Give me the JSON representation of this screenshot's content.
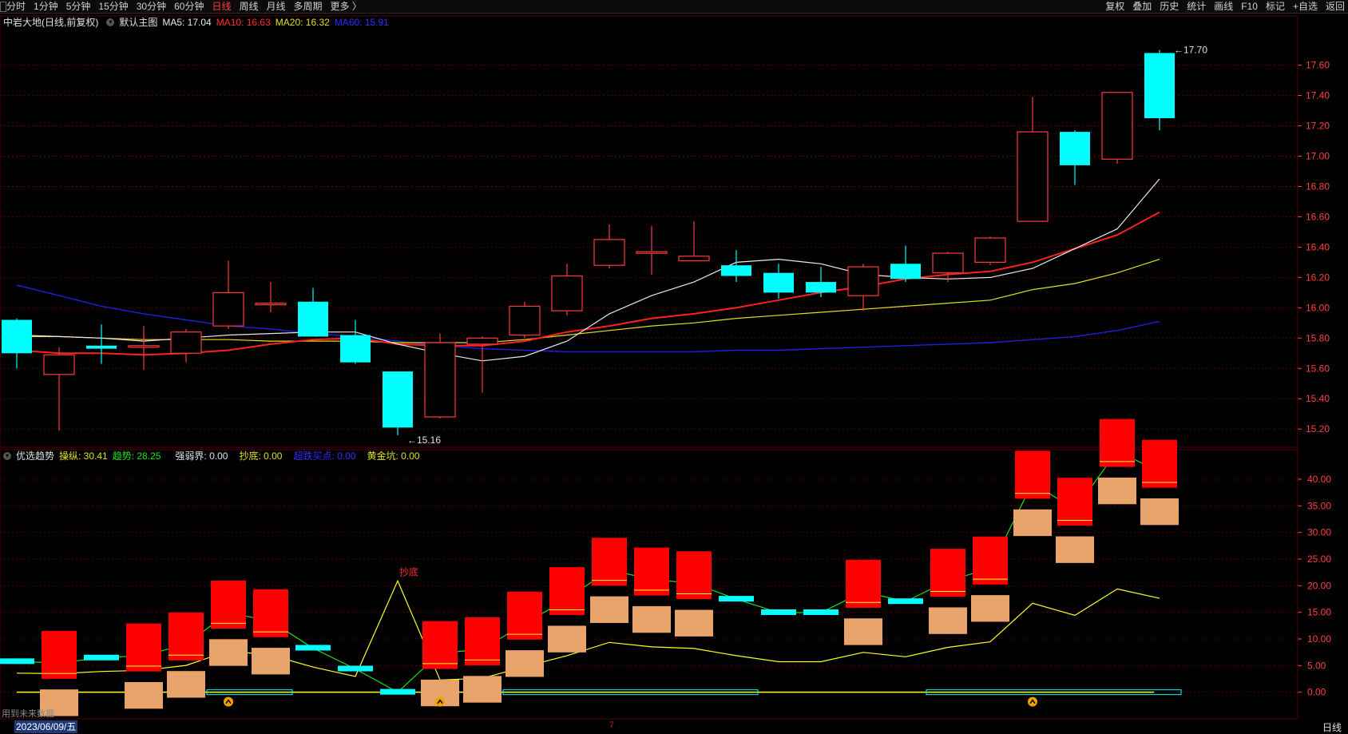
{
  "toolbar": {
    "periods": [
      "分时",
      "1分钟",
      "5分钟",
      "15分钟",
      "30分钟",
      "60分钟",
      "日线",
      "周线",
      "月线",
      "多周期",
      "更多 〉"
    ],
    "active_period": "日线",
    "tools": [
      "复权",
      "叠加",
      "历史",
      "统计",
      "画线",
      "F10",
      "标记",
      "+自选",
      "返回"
    ]
  },
  "main_header": {
    "stock": "中岩大地(日线,前复权)",
    "template": "默认主图",
    "ma5": "MA5: 17.04",
    "ma10": "MA10: 16.63",
    "ma20": "MA20: 16.32",
    "ma60": "MA60: 15.91"
  },
  "indicator_header": {
    "name": "优选趋势",
    "caozong": "操纵: 30.41",
    "qushi": "趋势: 28.25",
    "qiangruo": "强弱界: 0.00",
    "chaodi": "抄底: 0.00",
    "chaodie": "超跌买点: 0.00",
    "huangjin": "黄金坑: 0.00"
  },
  "colors": {
    "up": "#ff3b3b",
    "down": "#00ffff",
    "ma5": "#e8e8e8",
    "ma10": "#ff2020",
    "ma20": "#e0e020",
    "ma60": "#2020e0",
    "grid": "#5a0000",
    "axis": "#ff4040",
    "ind_red": "#ff0000",
    "ind_orange": "#e8a46a",
    "ind_yellow": "#ffff20",
    "ind_cyan": "#00ffff",
    "ind_green": "#20e020"
  },
  "price_axis": {
    "min": 15.08,
    "max": 17.84,
    "ticks": [
      "17.60",
      "17.40",
      "17.20",
      "17.00",
      "16.80",
      "16.60",
      "16.40",
      "16.20",
      "16.00",
      "15.80",
      "15.60",
      "15.40",
      "15.20"
    ],
    "tick_values": [
      17.6,
      17.4,
      17.2,
      17.0,
      16.8,
      16.6,
      16.4,
      16.2,
      16.0,
      15.8,
      15.6,
      15.4,
      15.2
    ]
  },
  "ind_axis": {
    "min": -5.0,
    "max": 43.0,
    "ticks": [
      "40.00",
      "35.00",
      "30.00",
      "25.00",
      "20.00",
      "15.00",
      "10.00",
      "5.00",
      "0.00"
    ],
    "tick_values": [
      40,
      35,
      30,
      25,
      20,
      15,
      10,
      5,
      0
    ]
  },
  "chart_data": {
    "type": "candlestick",
    "candles": [
      {
        "o": 15.92,
        "h": 15.93,
        "l": 15.6,
        "c": 15.7
      },
      {
        "o": 15.56,
        "h": 15.74,
        "l": 15.19,
        "c": 15.69
      },
      {
        "o": 15.75,
        "h": 15.89,
        "l": 15.63,
        "c": 15.73
      },
      {
        "o": 15.75,
        "h": 15.88,
        "l": 15.59,
        "c": 15.75
      },
      {
        "o": 15.7,
        "h": 15.86,
        "l": 15.64,
        "c": 15.84
      },
      {
        "o": 15.88,
        "h": 16.31,
        "l": 15.86,
        "c": 16.1
      },
      {
        "o": 16.02,
        "h": 16.17,
        "l": 15.97,
        "c": 16.03
      },
      {
        "o": 16.04,
        "h": 16.13,
        "l": 15.82,
        "c": 15.81
      },
      {
        "o": 15.82,
        "h": 15.92,
        "l": 15.63,
        "c": 15.64
      },
      {
        "o": 15.58,
        "h": 15.58,
        "l": 15.16,
        "c": 15.21
      },
      {
        "o": 15.28,
        "h": 15.83,
        "l": 15.27,
        "c": 15.77
      },
      {
        "o": 15.76,
        "h": 15.81,
        "l": 15.44,
        "c": 15.8
      },
      {
        "o": 15.82,
        "h": 16.04,
        "l": 15.8,
        "c": 16.01
      },
      {
        "o": 15.98,
        "h": 16.29,
        "l": 15.95,
        "c": 16.21
      },
      {
        "o": 16.28,
        "h": 16.55,
        "l": 16.26,
        "c": 16.45
      },
      {
        "o": 16.37,
        "h": 16.54,
        "l": 16.22,
        "c": 16.37
      },
      {
        "o": 16.31,
        "h": 16.57,
        "l": 16.31,
        "c": 16.34
      },
      {
        "o": 16.28,
        "h": 16.38,
        "l": 16.17,
        "c": 16.21
      },
      {
        "o": 16.23,
        "h": 16.29,
        "l": 16.06,
        "c": 16.1
      },
      {
        "o": 16.17,
        "h": 16.27,
        "l": 16.07,
        "c": 16.1
      },
      {
        "o": 16.08,
        "h": 16.29,
        "l": 15.98,
        "c": 16.27
      },
      {
        "o": 16.29,
        "h": 16.41,
        "l": 16.17,
        "c": 16.19
      },
      {
        "o": 16.23,
        "h": 16.37,
        "l": 16.17,
        "c": 16.36
      },
      {
        "o": 16.3,
        "h": 16.47,
        "l": 16.28,
        "c": 16.46
      },
      {
        "o": 16.57,
        "h": 17.39,
        "l": 16.57,
        "c": 17.16
      },
      {
        "o": 17.16,
        "h": 17.17,
        "l": 16.81,
        "c": 16.94
      },
      {
        "o": 16.98,
        "h": 17.42,
        "l": 16.95,
        "c": 17.42
      },
      {
        "o": 17.68,
        "h": 17.7,
        "l": 17.17,
        "c": 17.25
      }
    ],
    "ma5": [
      15.82,
      15.81,
      15.8,
      15.78,
      15.8,
      15.82,
      15.83,
      15.84,
      15.84,
      15.76,
      15.7,
      15.65,
      15.68,
      15.78,
      15.96,
      16.08,
      16.17,
      16.3,
      16.32,
      16.29,
      16.22,
      16.2,
      16.19,
      16.2,
      16.26,
      16.39,
      16.52,
      16.85
    ],
    "ma10": [
      15.72,
      15.7,
      15.7,
      15.69,
      15.7,
      15.72,
      15.76,
      15.79,
      15.8,
      15.76,
      15.75,
      15.75,
      15.78,
      15.84,
      15.88,
      15.93,
      15.96,
      16.0,
      16.05,
      16.1,
      16.14,
      16.19,
      16.22,
      16.24,
      16.3,
      16.39,
      16.48,
      16.63
    ],
    "ma20": [
      15.81,
      15.81,
      15.8,
      15.79,
      15.79,
      15.79,
      15.78,
      15.78,
      15.78,
      15.77,
      15.77,
      15.77,
      15.79,
      15.82,
      15.85,
      15.88,
      15.9,
      15.93,
      15.95,
      15.97,
      15.99,
      16.01,
      16.03,
      16.05,
      16.12,
      16.16,
      16.23,
      16.32
    ],
    "ma60": [
      16.15,
      16.08,
      16.01,
      15.96,
      15.92,
      15.88,
      15.86,
      15.83,
      15.81,
      15.78,
      15.75,
      15.73,
      15.72,
      15.71,
      15.71,
      15.71,
      15.71,
      15.72,
      15.72,
      15.73,
      15.74,
      15.75,
      15.76,
      15.77,
      15.79,
      15.81,
      15.85,
      15.91
    ],
    "high_label": "17.70",
    "low_label": "15.16",
    "chaodi_label": "抄底"
  },
  "status": {
    "date": "2023/06/09/五",
    "hint": "用到未来数据",
    "period": "日线",
    "mark": "7"
  }
}
